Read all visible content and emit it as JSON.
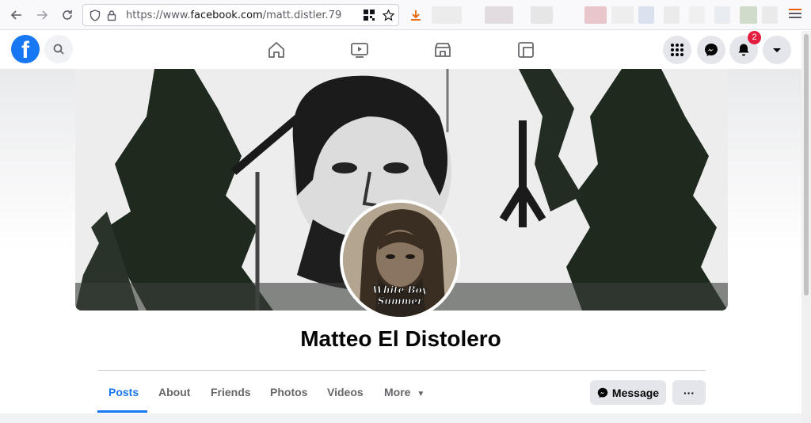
{
  "browser": {
    "url_prefix": "https://www.",
    "url_domain": "facebook.com",
    "url_path": "/matt.distler.79"
  },
  "icons": {
    "back": "back-arrow-icon",
    "forward": "forward-arrow-icon",
    "reload": "reload-icon",
    "shield": "shield-icon",
    "lock": "lock-icon",
    "qr": "qr-code-icon",
    "star": "bookmark-star-icon",
    "download": "download-icon",
    "menu": "hamburger-menu-icon"
  },
  "header": {
    "notification_count": "2"
  },
  "profile": {
    "name": "Matteo El Distolero",
    "avatar_caption_line1": "White Boy",
    "avatar_caption_line2": "Summer"
  },
  "tabs": [
    {
      "label": "Posts"
    },
    {
      "label": "About"
    },
    {
      "label": "Friends"
    },
    {
      "label": "Photos"
    },
    {
      "label": "Videos"
    },
    {
      "label": "More"
    }
  ],
  "actions": {
    "message_label": "Message",
    "more_label": "···"
  },
  "colors": {
    "brand": "#1877f2",
    "badge": "#e41e3f",
    "download_accent": "#e66000"
  }
}
